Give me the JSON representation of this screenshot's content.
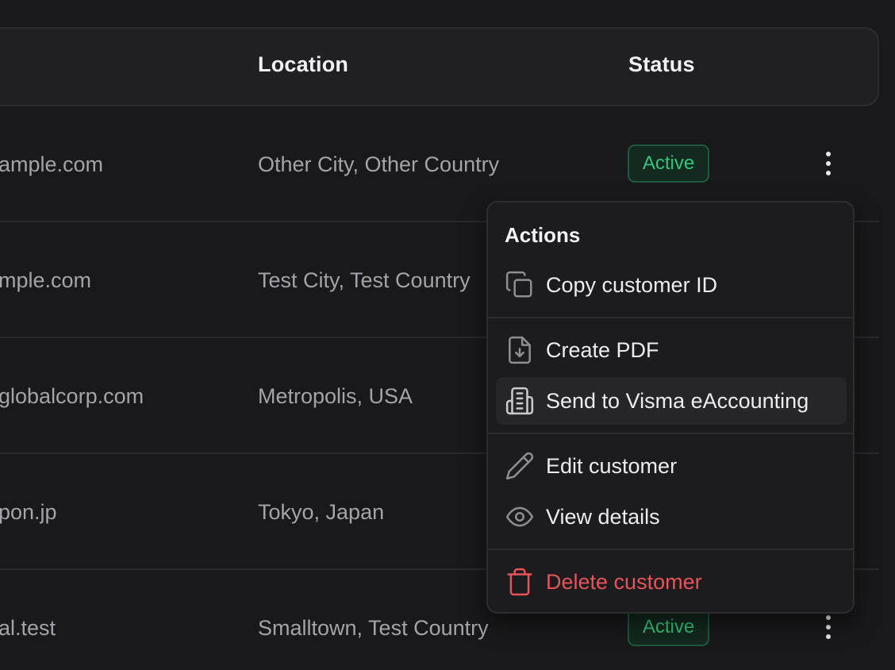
{
  "table": {
    "headers": {
      "location": "Location",
      "status": "Status"
    },
    "rows": [
      {
        "email": "ample.com",
        "location": "Other City, Other Country",
        "status": "Active"
      },
      {
        "email": "mple.com",
        "location": "Test City, Test Country",
        "status": ""
      },
      {
        "email": "globalcorp.com",
        "location": "Metropolis, USA",
        "status": ""
      },
      {
        "email": "pon.jp",
        "location": "Tokyo, Japan",
        "status": ""
      },
      {
        "email": "al.test",
        "location": "Smalltown, Test Country",
        "status": "Active"
      }
    ]
  },
  "menu": {
    "title": "Actions",
    "items": [
      {
        "label": "Copy customer ID",
        "icon": "copy-icon"
      },
      {
        "label": "Create PDF",
        "icon": "file-download-icon"
      },
      {
        "label": "Send to Visma eAccounting",
        "icon": "building-icon"
      },
      {
        "label": "Edit customer",
        "icon": "pencil-icon"
      },
      {
        "label": "View details",
        "icon": "eye-icon"
      },
      {
        "label": "Delete customer",
        "icon": "trash-icon"
      }
    ]
  },
  "colors": {
    "background": "#19191b",
    "badge_text": "#34c47b",
    "danger": "#e5545a"
  }
}
